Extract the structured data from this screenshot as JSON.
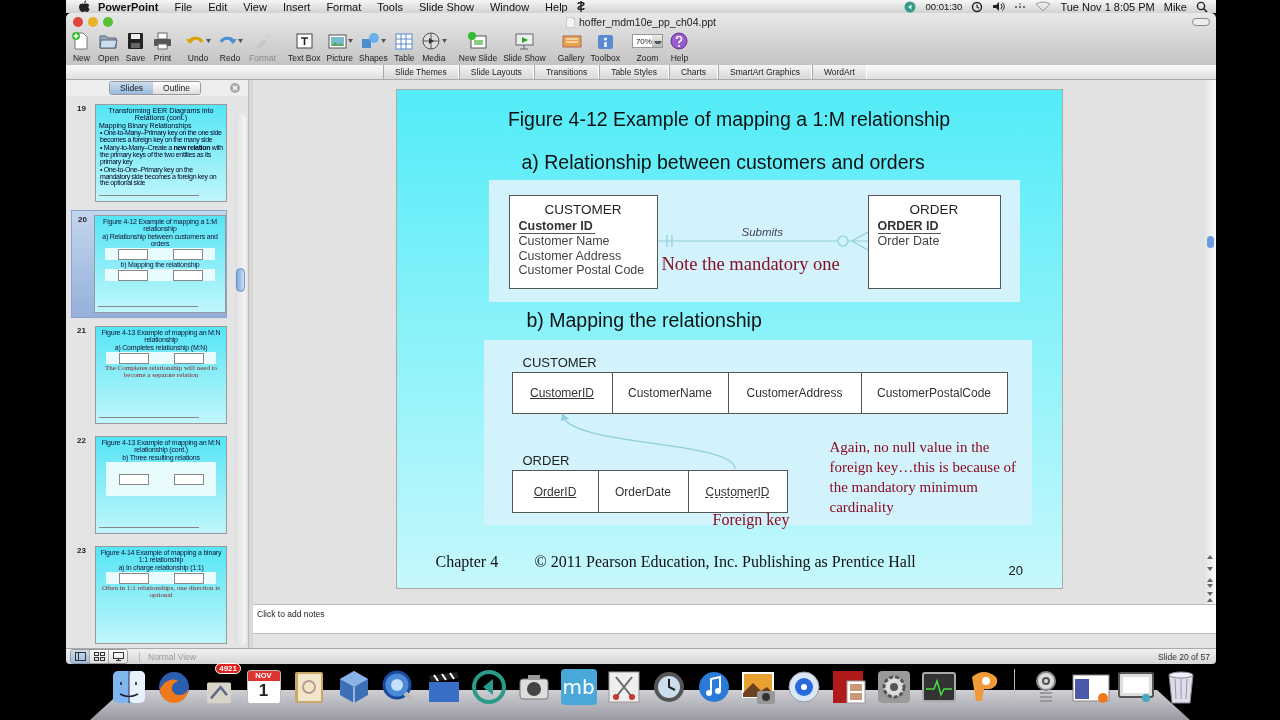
{
  "menu_bar": {
    "app": "PowerPoint",
    "menus": [
      "File",
      "Edit",
      "View",
      "Insert",
      "Format",
      "Tools",
      "Slide Show",
      "Window",
      "Help"
    ],
    "timer": "00:01:30",
    "clock": "Tue Nov 1  8:05 PM",
    "user": "Mike"
  },
  "window": {
    "title": "hoffer_mdm10e_pp_ch04.ppt"
  },
  "toolbar": [
    {
      "kind": "new",
      "label": "New",
      "disabled": false
    },
    {
      "kind": "open",
      "label": "Open",
      "disabled": false
    },
    {
      "kind": "save",
      "label": "Save",
      "disabled": false
    },
    {
      "kind": "print",
      "label": "Print",
      "disabled": false
    },
    {
      "kind": "undo",
      "label": "Undo",
      "disabled": false,
      "menu": true
    },
    {
      "kind": "redo",
      "label": "Redo",
      "disabled": false,
      "menu": true
    },
    {
      "kind": "format",
      "label": "Format",
      "disabled": true
    },
    {
      "kind": "textbox",
      "label": "Text Box",
      "disabled": false
    },
    {
      "kind": "picture",
      "label": "Picture",
      "disabled": false,
      "menu": true
    },
    {
      "kind": "shapes",
      "label": "Shapes",
      "disabled": false,
      "menu": true
    },
    {
      "kind": "table",
      "label": "Table",
      "disabled": false
    },
    {
      "kind": "media",
      "label": "Media",
      "disabled": false,
      "menu": true
    },
    {
      "kind": "newslide",
      "label": "New Slide",
      "disabled": false
    },
    {
      "kind": "slideshow",
      "label": "Slide Show",
      "disabled": false
    },
    {
      "kind": "gallery",
      "label": "Gallery",
      "disabled": false
    },
    {
      "kind": "toolbox",
      "label": "Toolbox",
      "disabled": false
    },
    {
      "kind": "zoom",
      "label": "Zoom",
      "value": "70%",
      "disabled": false
    },
    {
      "kind": "help",
      "label": "Help",
      "disabled": false
    }
  ],
  "ribbon_tabs": [
    "Slide Themes",
    "Slide Layouts",
    "Transitions",
    "Table Styles",
    "Charts",
    "SmartArt Graphics",
    "WordArt"
  ],
  "slide_pane": {
    "tabs": [
      {
        "label": "Slides",
        "selected": true
      },
      {
        "label": "Outline",
        "selected": false
      }
    ],
    "thumbnails": [
      {
        "number": "19",
        "selected": false,
        "lines": [
          {
            "kind": "bigtitle",
            "text": "Transforming EER Diagrams into Relations (cont.)"
          },
          {
            "kind": "heading",
            "text": "Mapping Binary Relationships"
          },
          {
            "kind": "bullet",
            "text": "• One-to-Many–Primary key on the one side becomes a foreign key on the many side"
          },
          {
            "kind": "bullet",
            "text": "• Many-to-Many–Create a **new relation** with the primary keys of the two entities as its primary key"
          },
          {
            "kind": "bullet",
            "text": "• One-to-One–Primary key on the mandatory side becomes a foreign key on the optional side"
          },
          {
            "kind": "footer"
          }
        ]
      },
      {
        "number": "20",
        "selected": true,
        "lines": [
          {
            "kind": "title",
            "text": "Figure 4-12 Example of mapping a 1:M relationship"
          },
          {
            "kind": "subtitle",
            "text": "a) Relationship between customers and orders"
          },
          {
            "kind": "diagram"
          },
          {
            "kind": "subtitle",
            "text": "b) Mapping the relationship"
          },
          {
            "kind": "diagram"
          },
          {
            "kind": "footer"
          }
        ]
      },
      {
        "number": "21",
        "selected": false,
        "lines": [
          {
            "kind": "title",
            "text": "Figure 4-13 Example of mapping an M:N relationship"
          },
          {
            "kind": "subtitle",
            "text": "a) Completes relationship (M:N)"
          },
          {
            "kind": "diagram"
          },
          {
            "kind": "note",
            "text": "The Completes relationship will need to become a separate relation"
          },
          {
            "kind": "footer"
          }
        ]
      },
      {
        "number": "22",
        "selected": false,
        "lines": [
          {
            "kind": "title",
            "text": "Figure 4-13 Example of mapping an M:N relationship (cont.)"
          },
          {
            "kind": "subtitle",
            "text": "b) Three resulting relations"
          },
          {
            "kind": "tall-diagram"
          },
          {
            "kind": "footer"
          }
        ]
      },
      {
        "number": "23",
        "selected": false,
        "lines": [
          {
            "kind": "title",
            "text": "Figure 4-14 Example of mapping a binary 1:1 relationship"
          },
          {
            "kind": "subtitle",
            "text": "a) In charge relationship (1:1)"
          },
          {
            "kind": "diagram"
          },
          {
            "kind": "note",
            "text": "Often in 1:1 relationships, one direction is optional"
          }
        ]
      }
    ]
  },
  "slide": {
    "title": "Figure 4-12 Example of mapping a 1:M relationship",
    "part_a": {
      "heading": "a) Relationship between customers and orders",
      "entities": [
        {
          "name": "CUSTOMER",
          "attributes": [
            {
              "text": "Customer ID",
              "identifier": true
            },
            {
              "text": "Customer Name",
              "identifier": false
            },
            {
              "text": "Customer Address",
              "identifier": false
            },
            {
              "text": "Customer Postal Code",
              "identifier": false
            }
          ]
        },
        {
          "name": "ORDER",
          "attributes": [
            {
              "text": "ORDER ID",
              "identifier": true
            },
            {
              "text": "Order Date",
              "identifier": false
            }
          ]
        }
      ],
      "relationship": "Submits",
      "note": "Note the mandatory one"
    },
    "part_b": {
      "heading": "b) Mapping the relationship",
      "relations": [
        {
          "name": "CUSTOMER",
          "columns": [
            {
              "text": "CustomerID",
              "kind": "primary"
            },
            {
              "text": "CustomerName",
              "kind": "plain"
            },
            {
              "text": "CustomerAddress",
              "kind": "plain"
            },
            {
              "text": "CustomerPostalCode",
              "kind": "plain"
            }
          ]
        },
        {
          "name": "ORDER",
          "columns": [
            {
              "text": "OrderID",
              "kind": "primary"
            },
            {
              "text": "OrderDate",
              "kind": "plain"
            },
            {
              "text": "CustomerID",
              "kind": "foreign"
            }
          ]
        }
      ],
      "foreign_key_label": "Foreign key",
      "note": "Again, no null value in the foreign key…this is because of the mandatory minimum cardinality"
    },
    "footer": {
      "chapter": "Chapter 4",
      "copyright": "© 2011 Pearson Education, Inc.  Publishing as Prentice Hall",
      "page": "20"
    }
  },
  "notes": {
    "placeholder": "Click to add notes"
  },
  "status_bar": {
    "view": "Normal View",
    "position": "Slide 20 of 57"
  },
  "dock": [
    {
      "kind": "finder"
    },
    {
      "kind": "firefox"
    },
    {
      "kind": "mail",
      "badge": "4921"
    },
    {
      "kind": "calendar",
      "month": "NOV",
      "day": "1"
    },
    {
      "kind": "addressbook"
    },
    {
      "kind": "virtualbox"
    },
    {
      "kind": "quicktime"
    },
    {
      "kind": "clapper"
    },
    {
      "kind": "back"
    },
    {
      "kind": "camera"
    },
    {
      "kind": "mb",
      "text": "mb"
    },
    {
      "kind": "scissors"
    },
    {
      "kind": "timemachine"
    },
    {
      "kind": "itunes"
    },
    {
      "kind": "photo"
    },
    {
      "kind": "dvd"
    },
    {
      "kind": "photobooth"
    },
    {
      "kind": "prefs"
    },
    {
      "kind": "monitor"
    },
    {
      "kind": "ppt"
    },
    {
      "kind": "separator"
    },
    {
      "kind": "at"
    },
    {
      "kind": "window"
    },
    {
      "kind": "screen"
    },
    {
      "kind": "trash"
    }
  ]
}
